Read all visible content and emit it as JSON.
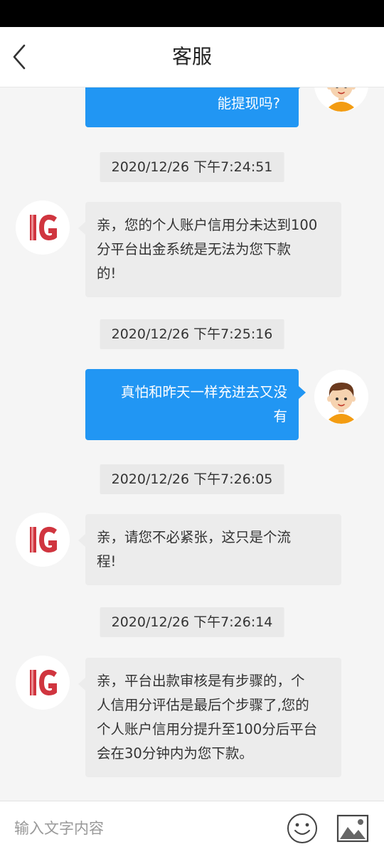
{
  "header": {
    "title": "客服"
  },
  "messages": [
    {
      "side": "right",
      "text": "能提现吗?"
    },
    {
      "time": "2020/12/26 下午7:24:51"
    },
    {
      "side": "left",
      "lines": [
        "亲，您的个人账户信用分未达到100",
        "分平台出金系统是无法为您下款",
        "的!"
      ]
    },
    {
      "time": "2020/12/26 下午7:25:16"
    },
    {
      "side": "right",
      "lines": [
        "真怕和昨天一样充进去又没",
        "有"
      ]
    },
    {
      "time": "2020/12/26 下午7:26:05"
    },
    {
      "side": "left",
      "lines": [
        "亲，请您不必紧张，这只是个流",
        "程!"
      ]
    },
    {
      "time": "2020/12/26 下午7:26:14"
    },
    {
      "side": "left",
      "lines": [
        "亲，平台出款审核是有步骤的，个",
        "人信用分评估是最后个步骤了,您的",
        "个人账户信用分提升至100分后平台",
        "会在30分钟内为您下款。"
      ]
    }
  ],
  "input": {
    "placeholder": "输入文字内容"
  },
  "icons": {
    "back": "chevron-left-icon",
    "emoji": "smiley-icon",
    "image": "image-icon",
    "agent_logo": "ig-logo",
    "user_avatar": "boy-avatar"
  },
  "colors": {
    "accent": "#2196f3",
    "agent_bubble": "#ececec",
    "timestamp_bg": "#e9e9e9",
    "logo_red": "#d0353f"
  }
}
